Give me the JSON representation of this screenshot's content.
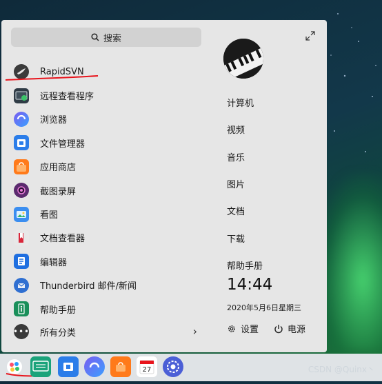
{
  "search": {
    "label": "搜索"
  },
  "apps": [
    {
      "label": "RapidSVN",
      "icon": "rapidsvn-icon"
    },
    {
      "label": "远程查看程序",
      "icon": "remote-viewer-icon"
    },
    {
      "label": "浏览器",
      "icon": "browser-icon"
    },
    {
      "label": "文件管理器",
      "icon": "file-manager-icon"
    },
    {
      "label": "应用商店",
      "icon": "app-store-icon"
    },
    {
      "label": "截图录屏",
      "icon": "screenshot-icon"
    },
    {
      "label": "看图",
      "icon": "image-viewer-icon"
    },
    {
      "label": "文档查看器",
      "icon": "document-viewer-icon"
    },
    {
      "label": "编辑器",
      "icon": "editor-icon"
    },
    {
      "label": "Thunderbird 邮件/新闻",
      "icon": "thunderbird-icon"
    },
    {
      "label": "帮助手册",
      "icon": "help-manual-icon"
    }
  ],
  "all_categories": {
    "label": "所有分类"
  },
  "places": [
    "计算机",
    "视频",
    "音乐",
    "图片",
    "文档",
    "下载",
    "帮助手册"
  ],
  "clock": {
    "time": "14:44",
    "date": "2020年5月6日星期三"
  },
  "actions": {
    "settings": "设置",
    "power": "电源"
  },
  "watermark": "CSDN @Quinx丶",
  "colors": {
    "launcher_bg": "#e6e6e6",
    "annotation_red": "#e8141c",
    "accent_blue": "#2b7de9"
  }
}
